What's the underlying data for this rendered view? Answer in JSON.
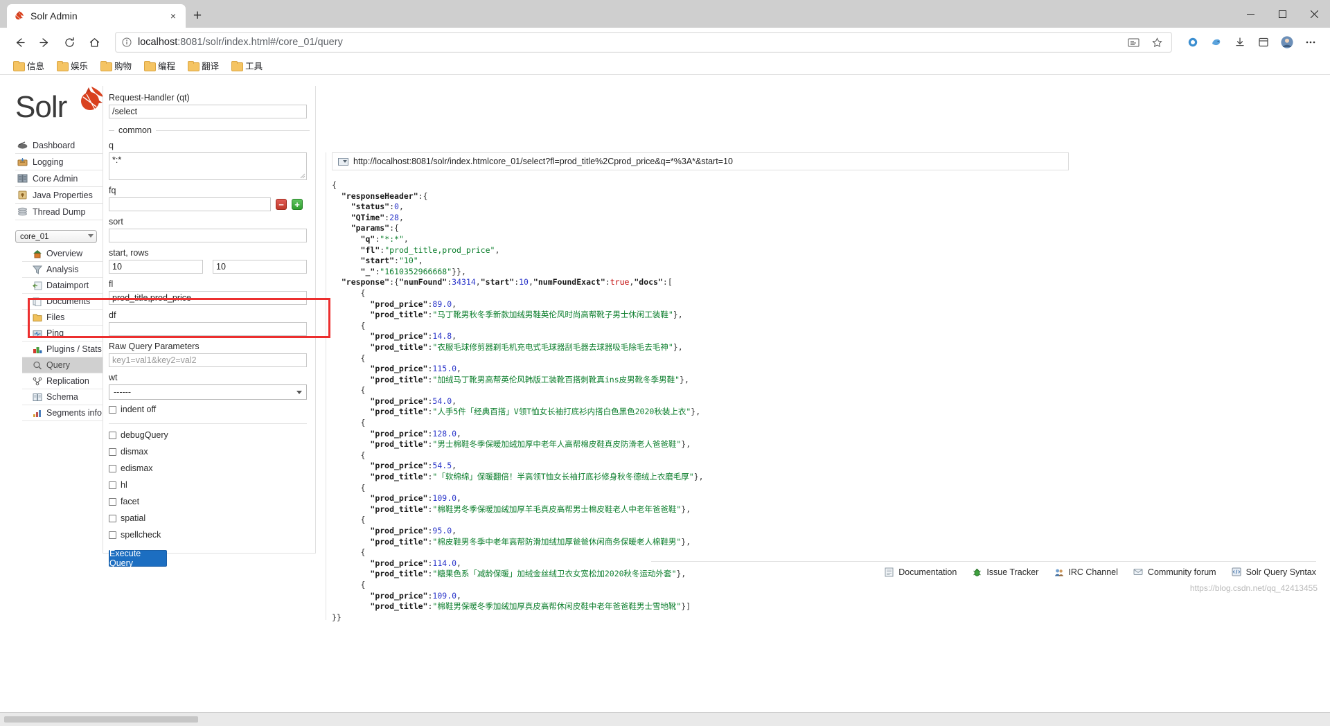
{
  "browser": {
    "tab": {
      "title": "Solr Admin",
      "favicon": "solr-icon",
      "close": "×"
    },
    "newtab_label": "+",
    "window_controls": {
      "minimize": "─",
      "maximize": "☐",
      "close": "✕"
    },
    "omnibox": {
      "info_icon": "info-circle-icon",
      "host": "localhost",
      "path": ":8081/solr/index.html#/core_01/query",
      "full_url": "localhost:8081/solr/index.html#/core_01/query",
      "reader_icon": "reader-view-icon",
      "star_icon": "bookmark-star-icon"
    },
    "nav": {
      "back": "back-arrow-icon",
      "forward": "forward-arrow-icon",
      "reload": "reload-icon",
      "home": "home-icon"
    },
    "toolbar_right": [
      {
        "name": "collections-icon"
      },
      {
        "name": "extension-bird-icon"
      },
      {
        "name": "downloads-icon"
      },
      {
        "name": "collections-panel-icon"
      },
      {
        "name": "profile-avatar-icon"
      },
      {
        "name": "settings-more-icon"
      }
    ],
    "bookmarks": [
      {
        "label": "信息"
      },
      {
        "label": "娱乐"
      },
      {
        "label": "购物"
      },
      {
        "label": "编程"
      },
      {
        "label": "翻译"
      },
      {
        "label": "工具"
      }
    ]
  },
  "solr": {
    "logo_text": "Solr",
    "main_menu": [
      {
        "label": "Dashboard",
        "icon": "dashboard-icon"
      },
      {
        "label": "Logging",
        "icon": "logging-icon"
      },
      {
        "label": "Core Admin",
        "icon": "core-admin-icon"
      },
      {
        "label": "Java Properties",
        "icon": "java-properties-icon"
      },
      {
        "label": "Thread Dump",
        "icon": "thread-dump-icon"
      }
    ],
    "core_selector": {
      "value": "core_01"
    },
    "core_menu": [
      {
        "label": "Overview",
        "icon": "overview-home-icon",
        "active": false
      },
      {
        "label": "Analysis",
        "icon": "analysis-funnel-icon",
        "active": false
      },
      {
        "label": "Dataimport",
        "icon": "dataimport-icon",
        "active": false
      },
      {
        "label": "Documents",
        "icon": "documents-icon",
        "active": false
      },
      {
        "label": "Files",
        "icon": "files-folder-icon",
        "active": false
      },
      {
        "label": "Ping",
        "icon": "ping-icon",
        "active": false
      },
      {
        "label": "Plugins / Stats",
        "icon": "plugins-stats-icon",
        "active": false
      },
      {
        "label": "Query",
        "icon": "query-magnifier-icon",
        "active": true
      },
      {
        "label": "Replication",
        "icon": "replication-icon",
        "active": false
      },
      {
        "label": "Schema",
        "icon": "schema-book-icon",
        "active": false
      },
      {
        "label": "Segments info",
        "icon": "segments-info-icon",
        "active": false
      }
    ],
    "form": {
      "request_handler_label": "Request-Handler (qt)",
      "request_handler_value": "/select",
      "common_legend": "common",
      "q_label": "q",
      "q_value": "*:*",
      "fq_label": "fq",
      "fq_value": "",
      "fq_remove_label": "−",
      "fq_add_label": "+",
      "sort_label": "sort",
      "sort_value": "",
      "start_rows_label": "start, rows",
      "start_value": "10",
      "rows_value": "10",
      "fl_label": "fl",
      "fl_value": "prod_title,prod_price",
      "df_label": "df",
      "df_value": "",
      "raw_params_label": "Raw Query Parameters",
      "raw_params_placeholder": "key1=val1&key2=val2",
      "wt_label": "wt",
      "wt_value": "------",
      "indent_off_label": "indent off",
      "checkboxes": [
        {
          "label": "debugQuery",
          "checked": false
        },
        {
          "label": "dismax",
          "checked": false
        },
        {
          "label": "edismax",
          "checked": false
        },
        {
          "label": "hl",
          "checked": false
        },
        {
          "label": "facet",
          "checked": false
        },
        {
          "label": "spatial",
          "checked": false
        },
        {
          "label": "spellcheck",
          "checked": false
        }
      ],
      "execute_label": "Execute Query"
    },
    "result": {
      "url": "http://localhost:8081/solr/index.htmlcore_01/select?fl=prod_title%2Cprod_price&q=*%3A*&start=10",
      "response_header": {
        "status": 0,
        "QTime": 28,
        "params": {
          "q": "*:*",
          "fl": "prod_title,prod_price",
          "start": "10",
          "_": "1610352966668"
        }
      },
      "response": {
        "numFound": 34314,
        "start": 10,
        "numFoundExact": true,
        "docs": [
          {
            "prod_price": "89.0",
            "prod_title": "马丁靴男秋冬季新款加绒男鞋英伦风时尚高帮靴子男士休闲工装鞋"
          },
          {
            "prod_price": "14.8",
            "prod_title": "衣服毛球修剪器剃毛机充电式毛球器刮毛器去球器吸毛除毛去毛神"
          },
          {
            "prod_price": "115.0",
            "prod_title": "加绒马丁靴男高帮英伦风韩版工装靴百搭刺靴真ins皮男靴冬季男鞋"
          },
          {
            "prod_price": "54.0",
            "prod_title": "人手5件「经典百搭」V领T恤女长袖打底衫内搭白色黑色2020秋装上衣"
          },
          {
            "prod_price": "128.0",
            "prod_title": "男士棉鞋冬季保暖加绒加厚中老年人高帮棉皮鞋真皮防滑老人爸爸鞋"
          },
          {
            "prod_price": "54.5",
            "prod_title": "「软绵绵」保暖翻倍！半高领T恤女长袖打底衫修身秋冬德绒上衣磨毛厚"
          },
          {
            "prod_price": "109.0",
            "prod_title": "棉鞋男冬季保暖加绒加厚羊毛真皮高帮男士棉皮鞋老人中老年爸爸鞋"
          },
          {
            "prod_price": "95.0",
            "prod_title": "棉皮鞋男冬季中老年高帮防滑加绒加厚爸爸休闲商务保暖老人棉鞋男"
          },
          {
            "prod_price": "114.0",
            "prod_title": "糖果色系「减龄保暖」加绒金丝绒卫衣女宽松加2020秋冬运动外套"
          },
          {
            "prod_price": "109.0",
            "prod_title": "棉鞋男保暖冬季加绒加厚真皮高帮休闲皮鞋中老年爸爸鞋男士雪地靴"
          }
        ]
      }
    },
    "footer_links": [
      {
        "label": "Documentation",
        "icon": "documentation-icon"
      },
      {
        "label": "Issue Tracker",
        "icon": "issue-tracker-bug-icon"
      },
      {
        "label": "IRC Channel",
        "icon": "irc-channel-icon"
      },
      {
        "label": "Community forum",
        "icon": "community-forum-icon"
      },
      {
        "label": "Solr Query Syntax",
        "icon": "solr-query-syntax-icon"
      }
    ],
    "watermark": "https://blog.csdn.net/qq_42413455"
  },
  "colors": {
    "solr_red": "#d9411e",
    "accent_blue": "#1c6ec1",
    "annotation_red": "#ec2f2f",
    "json_string": "#0a7d2b",
    "json_number": "#2a35c9",
    "json_bool": "#c00000",
    "active_menu_bg": "#d0d0d0"
  }
}
